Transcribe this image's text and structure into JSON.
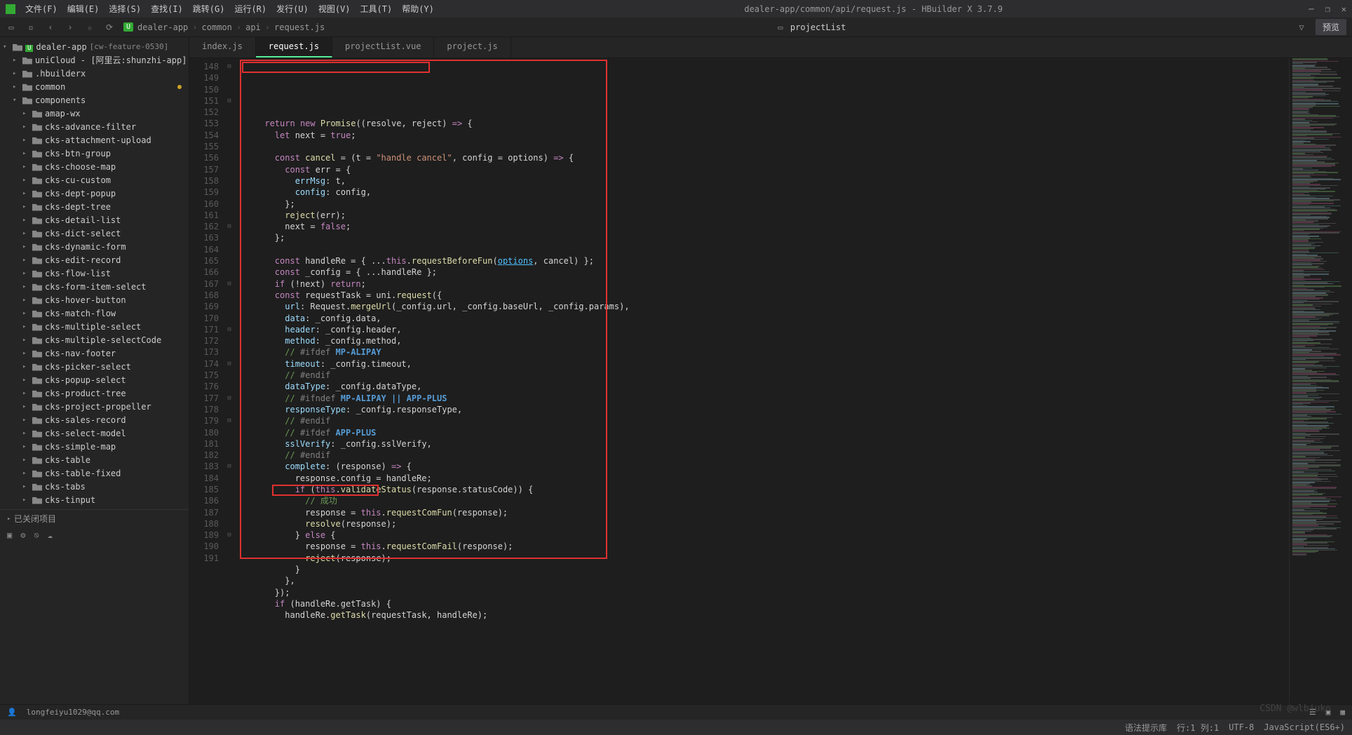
{
  "window": {
    "title": "dealer-app/common/api/request.js - HBuilder X 3.7.9"
  },
  "menus": {
    "file": "文件(F)",
    "edit": "编辑(E)",
    "select": "选择(S)",
    "find": "查找(I)",
    "goto": "跳转(G)",
    "run": "运行(R)",
    "release": "发行(U)",
    "view": "视图(V)",
    "tool": "工具(T)",
    "help": "帮助(Y)"
  },
  "breadcrumb": {
    "project": "dealer-app",
    "p1": "common",
    "p2": "api",
    "p3": "request.js"
  },
  "projectlist_label": "projectList",
  "preview": "预览",
  "tabs": {
    "t0": "index.js",
    "t1": "request.js",
    "t2": "projectList.vue",
    "t3": "project.js"
  },
  "tree": {
    "root": "dealer-app",
    "root_branch": "[cw-feature-0530]",
    "unicloud": "uniCloud - [阿里云:shunzhi-app]",
    "hbuilderx": ".hbuilderx",
    "common": "common",
    "components": "components",
    "items": [
      "amap-wx",
      "cks-advance-filter",
      "cks-attachment-upload",
      "cks-btn-group",
      "cks-choose-map",
      "cks-cu-custom",
      "cks-dept-popup",
      "cks-dept-tree",
      "cks-detail-list",
      "cks-dict-select",
      "cks-dynamic-form",
      "cks-edit-record",
      "cks-flow-list",
      "cks-form-item-select",
      "cks-hover-button",
      "cks-match-flow",
      "cks-multiple-select",
      "cks-multiple-selectCode",
      "cks-nav-footer",
      "cks-picker-select",
      "cks-popup-select",
      "cks-product-tree",
      "cks-project-propeller",
      "cks-sales-record",
      "cks-select-model",
      "cks-simple-map",
      "cks-table",
      "cks-table-fixed",
      "cks-tabs",
      "cks-tinput"
    ],
    "closed": "已关闭项目"
  },
  "lines": {
    "start": 148,
    "end": 191
  },
  "status": {
    "hint": "语法提示库",
    "pos": "行:1  列:1",
    "encoding": "UTF-8",
    "lang": "JavaScript(ES6+)"
  },
  "account": "longfeiyu1029@qq.com",
  "watermark": "CSDN @wlbjuko"
}
